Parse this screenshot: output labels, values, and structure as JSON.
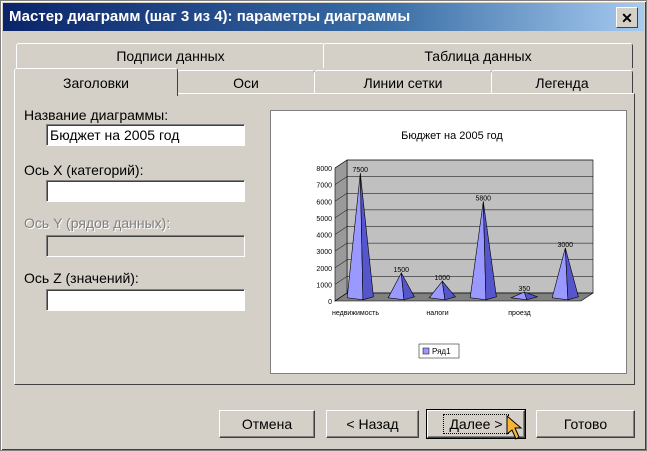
{
  "window": {
    "title": "Мастер диаграмм (шаг 3 из 4): параметры диаграммы",
    "close_glyph": "✕"
  },
  "tabs_back": [
    {
      "label": "Подписи данных"
    },
    {
      "label": "Таблица данных"
    }
  ],
  "tabs_front": [
    {
      "label": "Заголовки"
    },
    {
      "label": "Оси"
    },
    {
      "label": "Линии сетки"
    },
    {
      "label": "Легенда"
    }
  ],
  "form": {
    "chart_title_label": "Название диаграммы:",
    "chart_title_value": "Бюджет на 2005 год",
    "axis_x_label": "Ось X (категорий):",
    "axis_x_value": "",
    "axis_y_label": "Ось Y (рядов данных):",
    "axis_y_value": "",
    "axis_z_label": "Ось Z (значений):",
    "axis_z_value": ""
  },
  "chart_data": {
    "type": "bar",
    "title": "Бюджет на 2005 год",
    "categories": [
      "недвижимость",
      "",
      "налоги",
      "",
      "проезд",
      ""
    ],
    "x_tick_labels": [
      "недвижимость",
      "налоги",
      "проезд"
    ],
    "series": [
      {
        "name": "Ряд1",
        "values": [
          7500,
          1500,
          1000,
          5800,
          350,
          3000
        ],
        "color": "#9999ff"
      }
    ],
    "ylim": [
      0,
      8000
    ],
    "y_ticks": [
      0,
      1000,
      2000,
      3000,
      4000,
      5000,
      6000,
      7000,
      8000
    ],
    "grid": true,
    "legend": "bottom",
    "shape": "pyramid"
  },
  "buttons": {
    "cancel": "Отмена",
    "back": "< Назад",
    "next": "Далее >",
    "finish": "Готово"
  }
}
